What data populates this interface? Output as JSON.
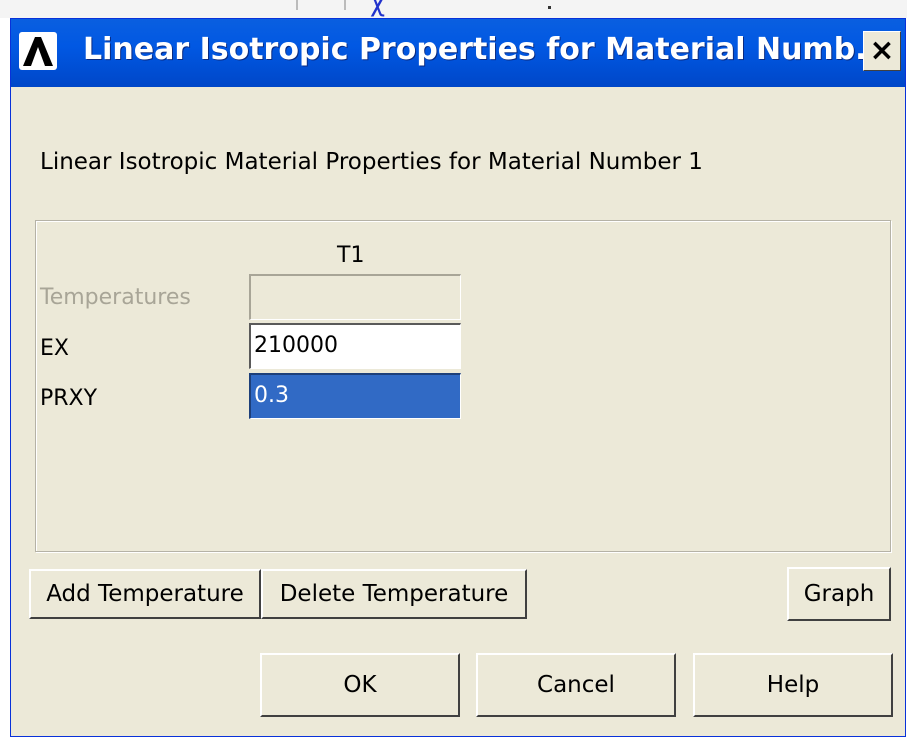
{
  "window": {
    "title": "Linear Isotropic Properties for Material Numb...",
    "close_glyph": "×",
    "icon": "ansys-logo-icon"
  },
  "dialog": {
    "subtitle": "Linear Isotropic Material Properties for Material Number 1",
    "column_header": "T1",
    "rows": [
      {
        "label": "Temperatures",
        "value": "",
        "state": "disabled"
      },
      {
        "label": "EX",
        "value": "210000",
        "state": "normal"
      },
      {
        "label": "PRXY",
        "value": "0.3",
        "state": "selected"
      }
    ]
  },
  "buttons": {
    "add_temperature": "Add Temperature",
    "delete_temperature": "Delete Temperature",
    "graph": "Graph",
    "ok": "OK",
    "cancel": "Cancel",
    "help": "Help"
  },
  "colors": {
    "titlebar": "#0158e3",
    "dialog_bg": "#ece9d8",
    "selection": "#316ac5"
  }
}
